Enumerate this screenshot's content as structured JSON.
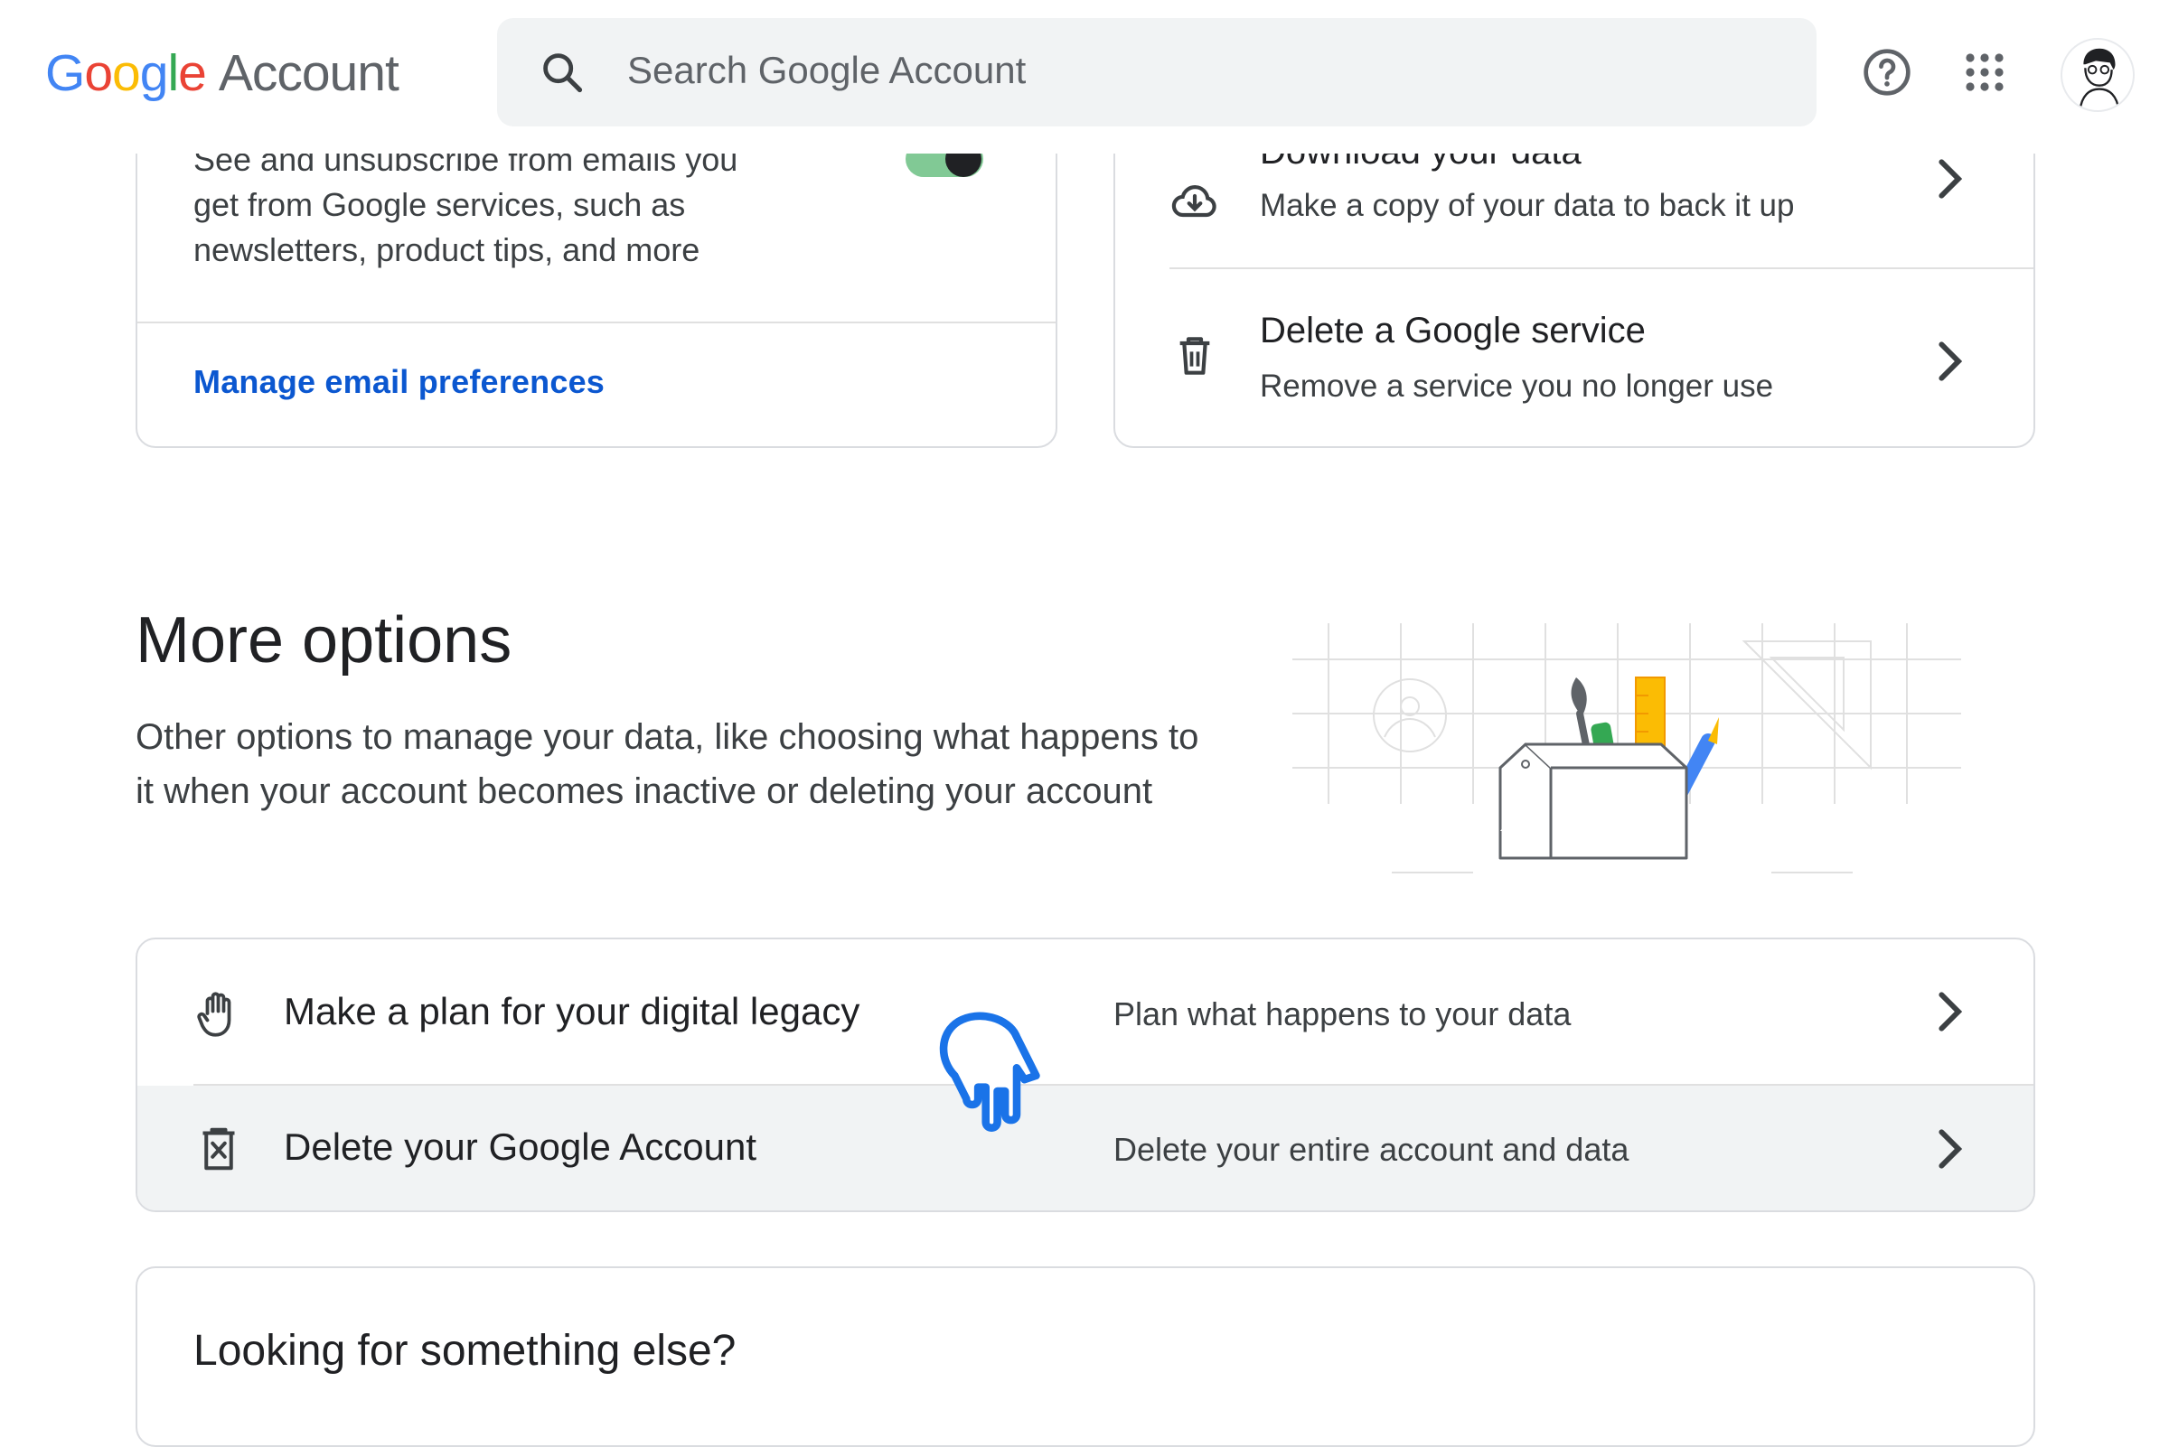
{
  "header": {
    "logo_letters": [
      "G",
      "o",
      "o",
      "g",
      "l",
      "e"
    ],
    "logo_suffix": "Account",
    "search_placeholder": "Search Google Account",
    "icons": [
      "search-icon",
      "help-icon",
      "apps-grid-icon",
      "avatar"
    ]
  },
  "email_card": {
    "description": "See and unsubscribe from emails you get from Google services, such as newsletters, product tips, and more",
    "toggle_on": true,
    "link_label": "Manage email preferences"
  },
  "data_card": {
    "rows": [
      {
        "title": "Download your data",
        "subtitle": "Make a copy of your data to back it up",
        "icon": "cloud-download-icon"
      },
      {
        "title": "Delete a Google service",
        "subtitle": "Remove a service you no longer use",
        "icon": "trash-icon"
      }
    ]
  },
  "more_options": {
    "title": "More options",
    "description": "Other options to manage your data, like choosing what happens to it when your account becomes inactive or deleting your account",
    "rows": [
      {
        "label": "Make a plan for your digital legacy",
        "desc": "Plan what happens to your data",
        "icon": "hand-icon"
      },
      {
        "label": "Delete your Google Account",
        "desc": "Delete your entire account and data",
        "icon": "delete-account-icon"
      }
    ]
  },
  "bottom_card": {
    "title": "Looking for something else?"
  },
  "colors": {
    "link": "#0b57d0",
    "toggle": "#81c995",
    "border": "#dadce0",
    "hover_row": "#f1f3f4",
    "cursor": "#1a73e8"
  }
}
